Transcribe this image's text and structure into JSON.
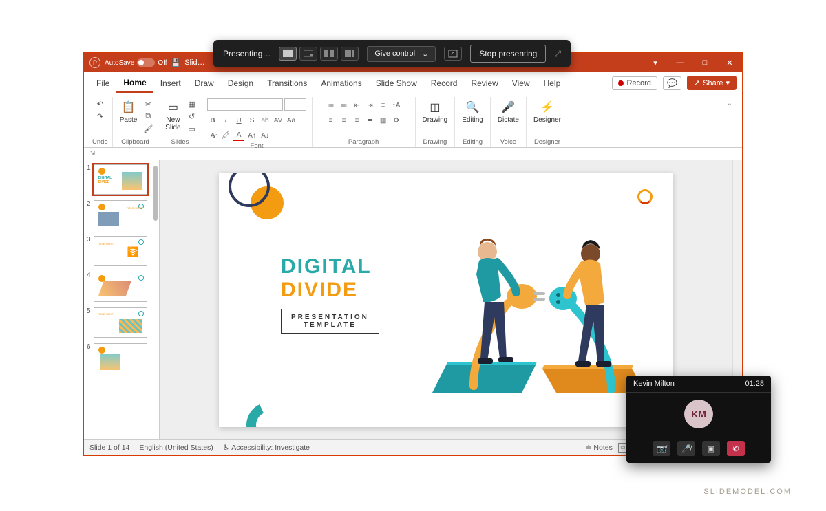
{
  "titlebar": {
    "autosave": "AutoSave",
    "autosave_state": "Off",
    "doc": "Slid…"
  },
  "win": {
    "min": "—",
    "max": "□",
    "close": "✕"
  },
  "tabs": {
    "file": "File",
    "home": "Home",
    "insert": "Insert",
    "draw": "Draw",
    "design": "Design",
    "transitions": "Transitions",
    "animations": "Animations",
    "slideshow": "Slide Show",
    "record": "Record",
    "review": "Review",
    "view": "View",
    "help": "Help"
  },
  "actions": {
    "record": "Record",
    "share": "Share"
  },
  "ribbon": {
    "undo": "Undo",
    "clipboard": {
      "label": "Clipboard",
      "paste": "Paste"
    },
    "slides": {
      "label": "Slides",
      "new": "New\nSlide"
    },
    "font": {
      "label": "Font",
      "placeholder": ""
    },
    "paragraph": {
      "label": "Paragraph"
    },
    "drawing": {
      "label": "Drawing",
      "btn": "Drawing"
    },
    "editing": {
      "label": "Editing",
      "btn": "Editing"
    },
    "voice": {
      "label": "Voice",
      "btn": "Dictate"
    },
    "designer": {
      "label": "Designer",
      "btn": "Designer"
    }
  },
  "thumbs": [
    "1",
    "2",
    "3",
    "4",
    "5",
    "6"
  ],
  "slide": {
    "t1": "DIGITAL",
    "t2": "DIVIDE",
    "sub1": "PRESENTATION",
    "sub2": "TEMPLATE"
  },
  "status": {
    "counter": "Slide 1 of 14",
    "lang": "English (United States)",
    "access": "Accessibility: Investigate",
    "notes": "Notes"
  },
  "present": {
    "status": "Presenting…",
    "give": "Give control",
    "stop": "Stop presenting"
  },
  "call": {
    "name": "Kevin Milton",
    "time": "01:28",
    "initials": "KM"
  },
  "watermark": "SLIDEMODEL.COM"
}
